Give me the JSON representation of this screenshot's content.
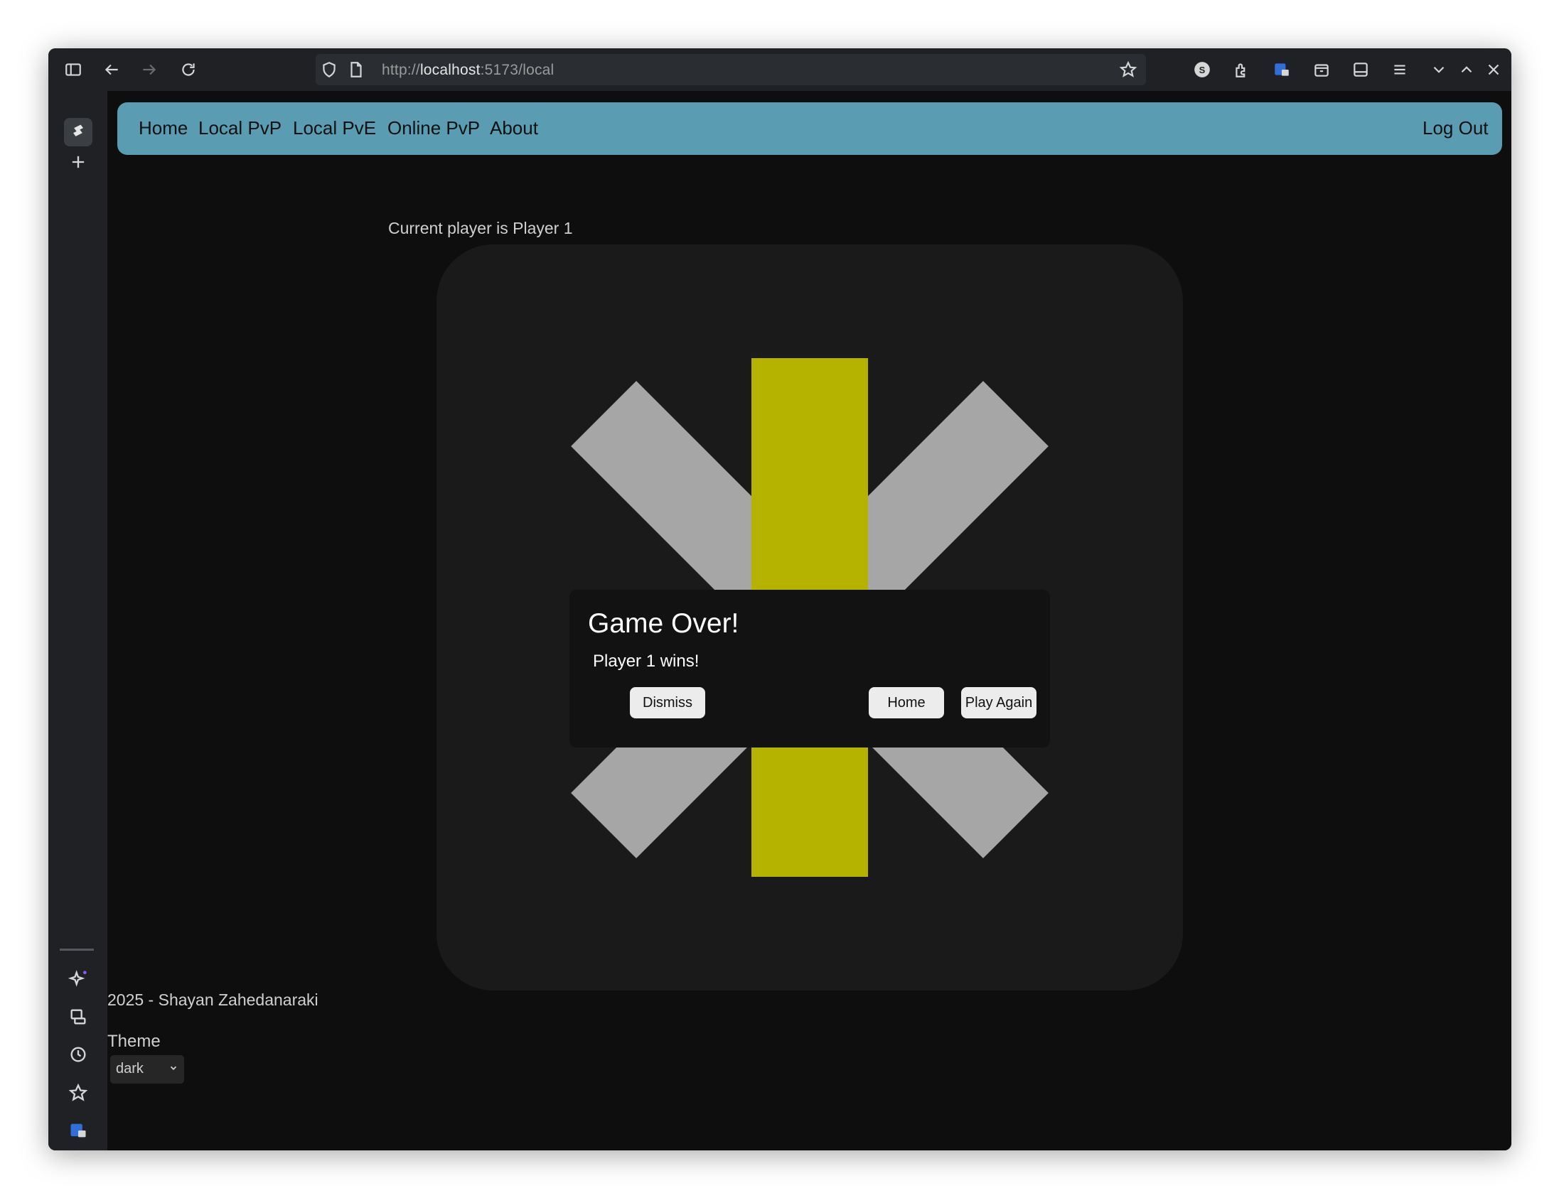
{
  "browser": {
    "url_prefix": "http://",
    "url_host": "localhost",
    "url_suffix": ":5173/local"
  },
  "nav": {
    "links": [
      "Home",
      "Local PvP",
      "Local PvE",
      "Online PvP",
      "About"
    ],
    "logout": "Log Out"
  },
  "game": {
    "current_player": "Current player is Player 1",
    "colors": {
      "board": "#1a1a1a",
      "x_mark": "#a6a6a6",
      "highlight": "#b5b300"
    }
  },
  "dialog": {
    "title": "Game Over!",
    "message": "Player 1 wins!",
    "dismiss": "Dismiss",
    "home": "Home",
    "play_again": "Play Again"
  },
  "footer": {
    "copyright": "2025 - Shayan Zahedanaraki",
    "theme_label": "Theme",
    "theme_value": "dark"
  }
}
